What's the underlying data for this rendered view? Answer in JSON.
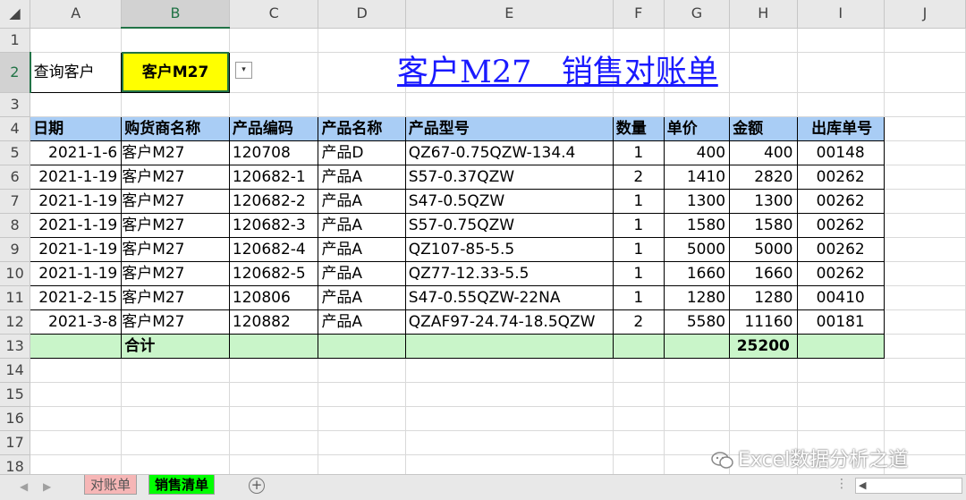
{
  "columns": [
    "A",
    "B",
    "C",
    "D",
    "E",
    "F",
    "G",
    "H",
    "I",
    "J"
  ],
  "rows": [
    "1",
    "2",
    "3",
    "4",
    "5",
    "6",
    "7",
    "8",
    "9",
    "10",
    "11",
    "12",
    "13",
    "14",
    "15",
    "16",
    "17",
    "18"
  ],
  "query": {
    "label": "查询客户",
    "value": "客户M27",
    "dropdown_glyph": "▾"
  },
  "title": "客户M27   销售对账单",
  "headers": [
    "日期",
    "购货商名称",
    "产品编码",
    "产品名称",
    "产品型号",
    "数量",
    "单价",
    "金额",
    "出库单号"
  ],
  "records": [
    [
      "2021-1-6",
      "客户M27",
      "120708",
      "产品D",
      "QZ67-0.75QZW-134.4",
      "1",
      "400",
      "400",
      "00148"
    ],
    [
      "2021-1-19",
      "客户M27",
      "120682-1",
      "产品A",
      "S57-0.37QZW",
      "2",
      "1410",
      "2820",
      "00262"
    ],
    [
      "2021-1-19",
      "客户M27",
      "120682-2",
      "产品A",
      "S47-0.5QZW",
      "1",
      "1300",
      "1300",
      "00262"
    ],
    [
      "2021-1-19",
      "客户M27",
      "120682-3",
      "产品A",
      "S57-0.75QZW",
      "1",
      "1580",
      "1580",
      "00262"
    ],
    [
      "2021-1-19",
      "客户M27",
      "120682-4",
      "产品A",
      "QZ107-85-5.5",
      "1",
      "5000",
      "5000",
      "00262"
    ],
    [
      "2021-1-19",
      "客户M27",
      "120682-5",
      "产品A",
      "QZ77-12.33-5.5",
      "1",
      "1660",
      "1660",
      "00262"
    ],
    [
      "2021-2-15",
      "客户M27",
      "120806",
      "产品A",
      "S47-0.55QZW-22NA",
      "1",
      "1280",
      "1280",
      "00410"
    ],
    [
      "2021-3-8",
      "客户M27",
      "120882",
      "产品A",
      "QZAF97-24.74-18.5QZW",
      "2",
      "5580",
      "11160",
      "00181"
    ]
  ],
  "total": {
    "label": "合计",
    "value": "25200"
  },
  "tabs": {
    "sheet1": "对账单",
    "sheet2": "销售清单",
    "add": "+",
    "prev": "◀",
    "next": "▶",
    "dots": "⋮",
    "scroll_left": "◀"
  },
  "watermark": "Excel数据分析之道",
  "colors": {
    "header_bg": "#a9cdf5",
    "total_bg": "#c9f5c9",
    "query_bg": "#ffff00",
    "title": "#1a1aff",
    "tab_active": "#00ff00",
    "tab_inactive": "#f6b6b6"
  }
}
